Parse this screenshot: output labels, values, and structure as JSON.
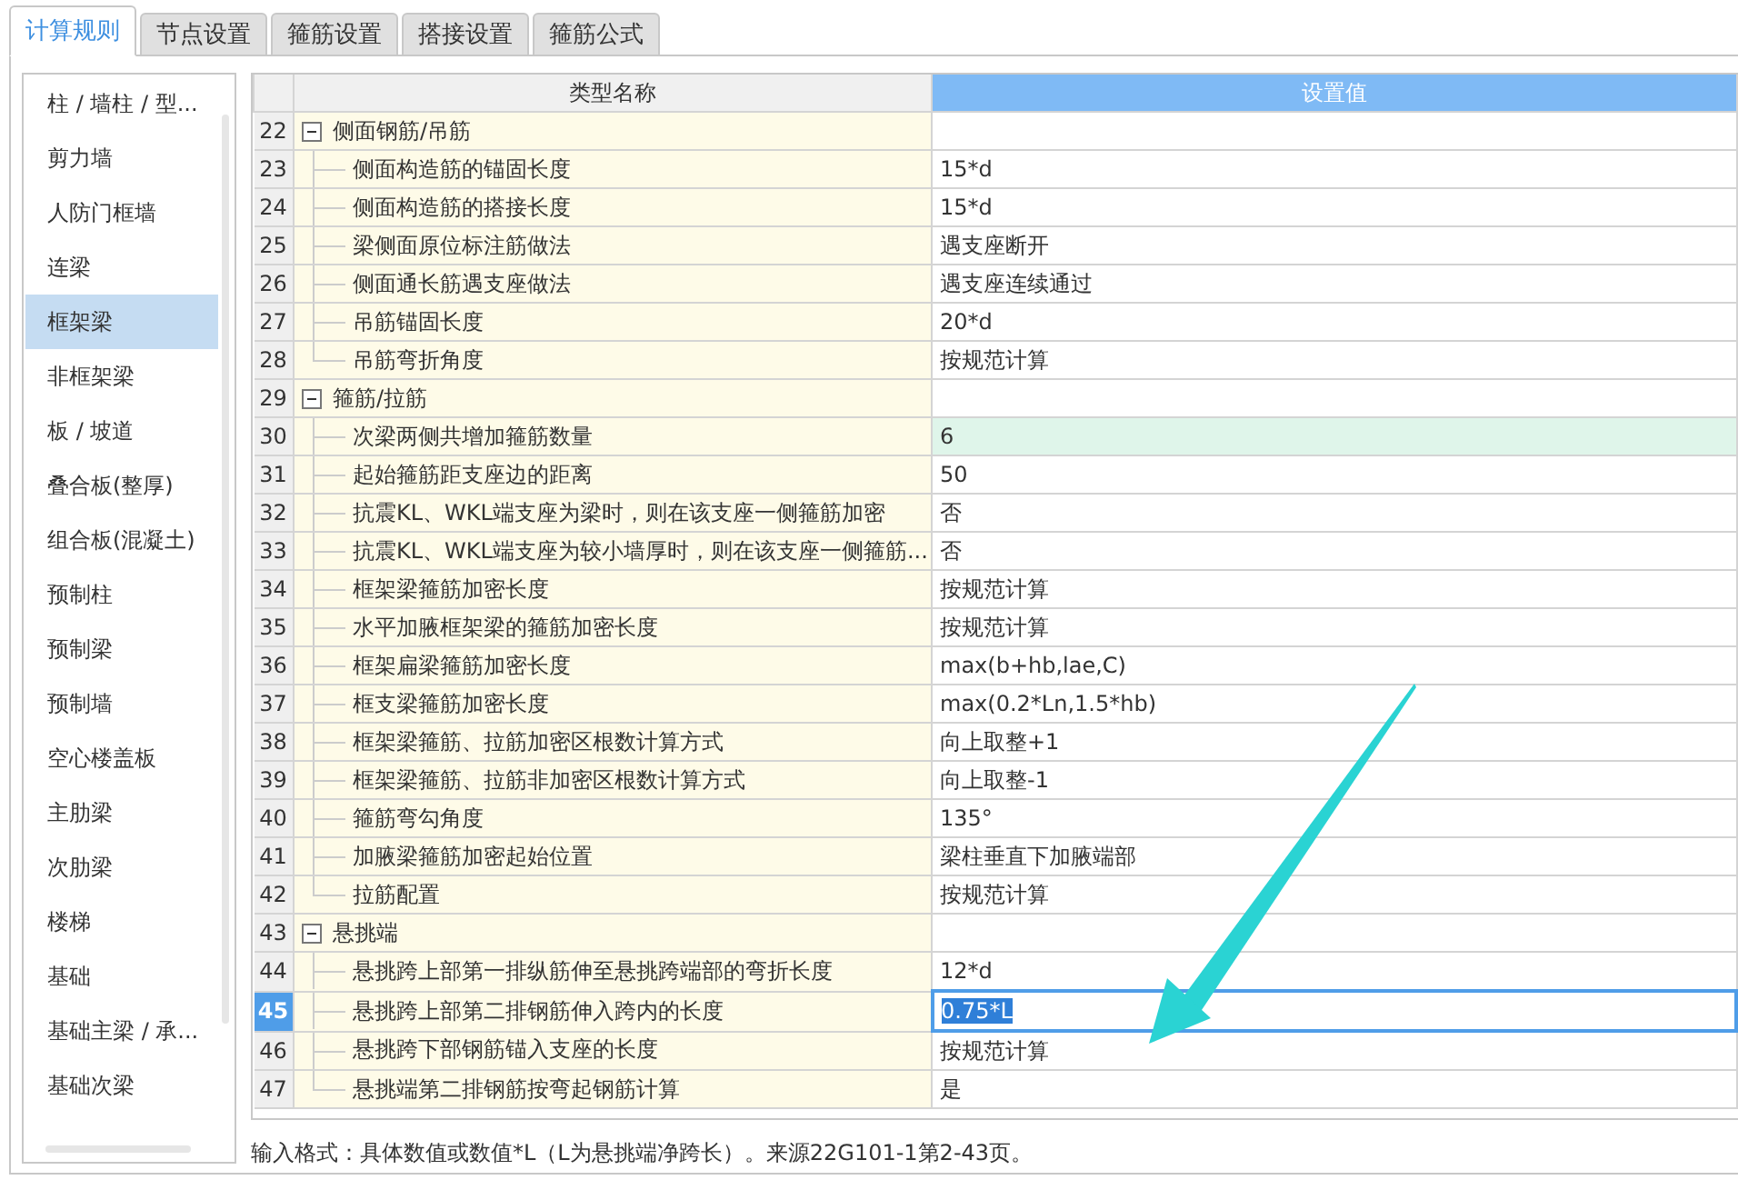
{
  "tabs": [
    {
      "label": "计算规则",
      "selected": true
    },
    {
      "label": "节点设置",
      "selected": false
    },
    {
      "label": "箍筋设置",
      "selected": false
    },
    {
      "label": "搭接设置",
      "selected": false
    },
    {
      "label": "箍筋公式",
      "selected": false
    }
  ],
  "sidebar": {
    "items": [
      {
        "label": "柱 / 墙柱 / 型...",
        "selected": false
      },
      {
        "label": "剪力墙",
        "selected": false
      },
      {
        "label": "人防门框墙",
        "selected": false
      },
      {
        "label": "连梁",
        "selected": false
      },
      {
        "label": "框架梁",
        "selected": true
      },
      {
        "label": "非框架梁",
        "selected": false
      },
      {
        "label": "板 / 坡道",
        "selected": false
      },
      {
        "label": "叠合板(整厚)",
        "selected": false
      },
      {
        "label": "组合板(混凝土)",
        "selected": false
      },
      {
        "label": "预制柱",
        "selected": false
      },
      {
        "label": "预制梁",
        "selected": false
      },
      {
        "label": "预制墙",
        "selected": false
      },
      {
        "label": "空心楼盖板",
        "selected": false
      },
      {
        "label": "主肋梁",
        "selected": false
      },
      {
        "label": "次肋梁",
        "selected": false
      },
      {
        "label": "楼梯",
        "selected": false
      },
      {
        "label": "基础",
        "selected": false
      },
      {
        "label": "基础主梁 / 承...",
        "selected": false
      },
      {
        "label": "基础次梁",
        "selected": false
      }
    ]
  },
  "table": {
    "columns": [
      "类型名称",
      "设置值"
    ],
    "rows": [
      {
        "number": "22",
        "kind": "group",
        "name": "侧面钢筋/吊筋",
        "expanded": true,
        "selected": false
      },
      {
        "number": "23",
        "kind": "item",
        "name": "侧面构造筋的锚固长度",
        "value": "15*d",
        "selected": false,
        "highlighted": false
      },
      {
        "number": "24",
        "kind": "item",
        "name": "侧面构造筋的搭接长度",
        "value": "15*d",
        "selected": false,
        "highlighted": false
      },
      {
        "number": "25",
        "kind": "item",
        "name": "梁侧面原位标注筋做法",
        "value": "遇支座断开",
        "selected": false,
        "highlighted": false
      },
      {
        "number": "26",
        "kind": "item",
        "name": "侧面通长筋遇支座做法",
        "value": "遇支座连续通过",
        "selected": false,
        "highlighted": false
      },
      {
        "number": "27",
        "kind": "item",
        "name": "吊筋锚固长度",
        "value": "20*d",
        "selected": false,
        "highlighted": false
      },
      {
        "number": "28",
        "kind": "item",
        "name": "吊筋弯折角度",
        "value": "按规范计算",
        "selected": false,
        "highlighted": false
      },
      {
        "number": "29",
        "kind": "group",
        "name": "箍筋/拉筋",
        "expanded": true,
        "selected": false
      },
      {
        "number": "30",
        "kind": "item",
        "name": "次梁两侧共增加箍筋数量",
        "value": "6",
        "selected": false,
        "highlighted": true
      },
      {
        "number": "31",
        "kind": "item",
        "name": "起始箍筋距支座边的距离",
        "value": "50",
        "selected": false,
        "highlighted": false
      },
      {
        "number": "32",
        "kind": "item",
        "name": "抗震KL、WKL端支座为梁时，则在该支座一侧箍筋加密",
        "value": "否",
        "selected": false,
        "highlighted": false
      },
      {
        "number": "33",
        "kind": "item",
        "name": "抗震KL、WKL端支座为较小墙厚时，则在该支座一侧箍筋...",
        "value": "否",
        "selected": false,
        "highlighted": false
      },
      {
        "number": "34",
        "kind": "item",
        "name": "框架梁箍筋加密长度",
        "value": "按规范计算",
        "selected": false,
        "highlighted": false
      },
      {
        "number": "35",
        "kind": "item",
        "name": "水平加腋框架梁的箍筋加密长度",
        "value": "按规范计算",
        "selected": false,
        "highlighted": false
      },
      {
        "number": "36",
        "kind": "item",
        "name": "框架扁梁箍筋加密长度",
        "value": "max(b+hb,lae,C)",
        "selected": false,
        "highlighted": false
      },
      {
        "number": "37",
        "kind": "item",
        "name": "框支梁箍筋加密长度",
        "value": "max(0.2*Ln,1.5*hb)",
        "selected": false,
        "highlighted": false
      },
      {
        "number": "38",
        "kind": "item",
        "name": "框架梁箍筋、拉筋加密区根数计算方式",
        "value": "向上取整+1",
        "selected": false,
        "highlighted": false
      },
      {
        "number": "39",
        "kind": "item",
        "name": "框架梁箍筋、拉筋非加密区根数计算方式",
        "value": "向上取整-1",
        "selected": false,
        "highlighted": false
      },
      {
        "number": "40",
        "kind": "item",
        "name": "箍筋弯勾角度",
        "value": "135°",
        "selected": false,
        "highlighted": false
      },
      {
        "number": "41",
        "kind": "item",
        "name": "加腋梁箍筋加密起始位置",
        "value": "梁柱垂直下加腋端部",
        "selected": false,
        "highlighted": false
      },
      {
        "number": "42",
        "kind": "item",
        "name": "拉筋配置",
        "value": "按规范计算",
        "selected": false,
        "highlighted": false
      },
      {
        "number": "43",
        "kind": "group",
        "name": "悬挑端",
        "expanded": true,
        "selected": false
      },
      {
        "number": "44",
        "kind": "item",
        "name": "悬挑跨上部第一排纵筋伸至悬挑跨端部的弯折长度",
        "value": "12*d",
        "selected": false,
        "highlighted": false
      },
      {
        "number": "45",
        "kind": "item",
        "name": "悬挑跨上部第二排钢筋伸入跨内的长度",
        "value": "0.75*L",
        "selected": true,
        "highlighted": false
      },
      {
        "number": "46",
        "kind": "item",
        "name": "悬挑跨下部钢筋锚入支座的长度",
        "value": "按规范计算",
        "selected": false,
        "highlighted": false
      },
      {
        "number": "47",
        "kind": "item",
        "name": "悬挑端第二排钢筋按弯起钢筋计算",
        "value": "是",
        "selected": false,
        "highlighted": false
      }
    ]
  },
  "note": "输入格式：具体数值或数值*L（L为悬挑端净跨长）。来源22G101-1第2-43页。"
}
